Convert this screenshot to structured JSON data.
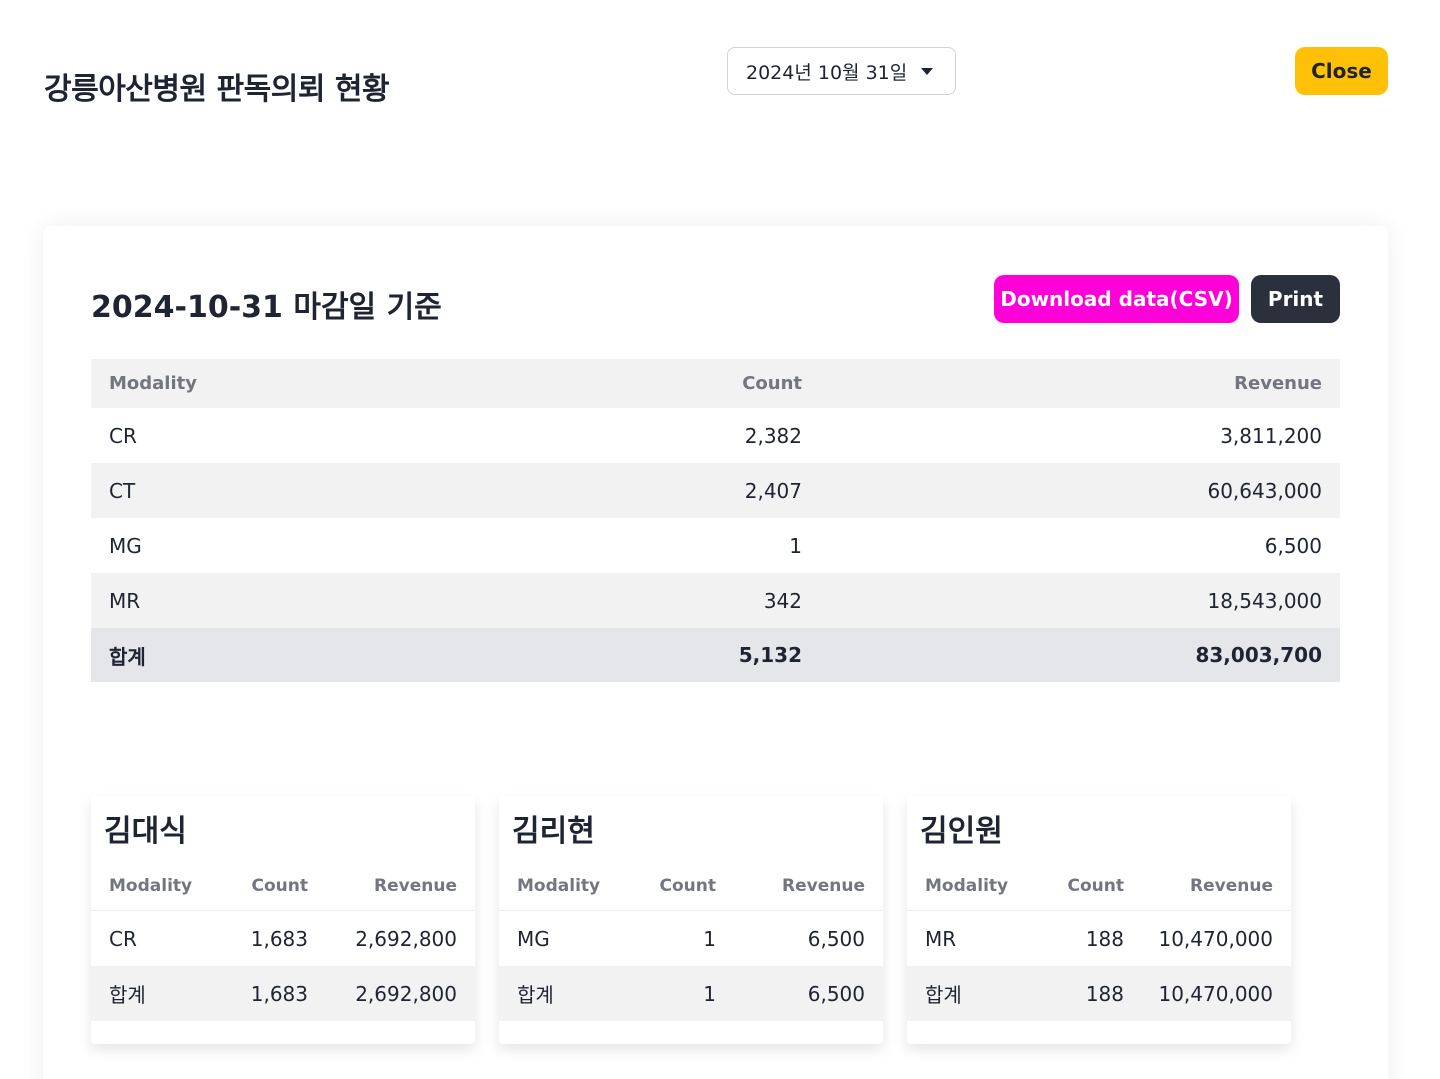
{
  "header": {
    "title": "강릉아산병원 판독의뢰 현황",
    "date_select": "2024년 10월 31일",
    "close_label": "Close"
  },
  "report": {
    "heading": "2024-10-31 마감일 기준",
    "download_label": "Download data(CSV)",
    "print_label": "Print",
    "columns": [
      "Modality",
      "Count",
      "Revenue"
    ],
    "rows": [
      {
        "modality": "CR",
        "count": "2,382",
        "revenue": "3,811,200"
      },
      {
        "modality": "CT",
        "count": "2,407",
        "revenue": "60,643,000"
      },
      {
        "modality": "MG",
        "count": "1",
        "revenue": "6,500"
      },
      {
        "modality": "MR",
        "count": "342",
        "revenue": "18,543,000"
      }
    ],
    "total": {
      "modality": "합계",
      "count": "5,132",
      "revenue": "83,003,700"
    }
  },
  "doctors": [
    {
      "name": "김대식",
      "columns": [
        "Modality",
        "Count",
        "Revenue"
      ],
      "rows": [
        {
          "modality": "CR",
          "count": "1,683",
          "revenue": "2,692,800"
        }
      ],
      "total": {
        "modality": "합계",
        "count": "1,683",
        "revenue": "2,692,800"
      }
    },
    {
      "name": "김리현",
      "columns": [
        "Modality",
        "Count",
        "Revenue"
      ],
      "rows": [
        {
          "modality": "MG",
          "count": "1",
          "revenue": "6,500"
        }
      ],
      "total": {
        "modality": "합계",
        "count": "1",
        "revenue": "6,500"
      }
    },
    {
      "name": "김인원",
      "columns": [
        "Modality",
        "Count",
        "Revenue"
      ],
      "rows": [
        {
          "modality": "MR",
          "count": "188",
          "revenue": "10,470,000"
        }
      ],
      "total": {
        "modality": "합계",
        "count": "188",
        "revenue": "10,470,000"
      }
    }
  ],
  "colors": {
    "close_button": "#ffc107",
    "download_button": "#ff00d9",
    "print_button": "#2b303d"
  }
}
